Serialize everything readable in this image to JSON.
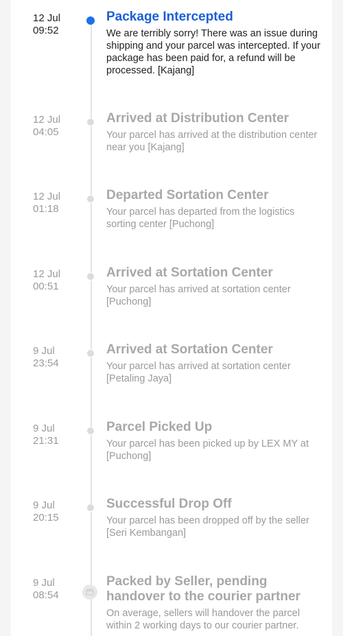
{
  "tracking": {
    "events": [
      {
        "date": "12 Jul",
        "time": "09:52",
        "title": "Package Intercepted",
        "description": "We are terribly sorry! There was an issue during shipping and your parcel was intercepted. If your package has been paid for, a refund will be processed. [Kajang]",
        "status": "current",
        "icon": "active-dot-icon"
      },
      {
        "date": "12 Jul",
        "time": "04:05",
        "title": "Arrived at Distribution Center",
        "description": "Your parcel has arrived at the distribution center near you [Kajang]",
        "status": "past",
        "icon": "dot-icon"
      },
      {
        "date": "12 Jul",
        "time": "01:18",
        "title": "Departed Sortation Center",
        "description": "Your parcel has departed from the logistics sorting center [Puchong]",
        "status": "past",
        "icon": "dot-icon"
      },
      {
        "date": "12 Jul",
        "time": "00:51",
        "title": "Arrived at Sortation Center",
        "description": "Your parcel has arrived at sortation center [Puchong]",
        "status": "past",
        "icon": "dot-icon"
      },
      {
        "date": "9 Jul",
        "time": "23:54",
        "title": "Arrived at Sortation Center",
        "description": "Your parcel has arrived at sortation center [Petaling Jaya]",
        "status": "past",
        "icon": "dot-icon"
      },
      {
        "date": "9 Jul",
        "time": "21:31",
        "title": "Parcel Picked Up",
        "description": "Your parcel has been picked up by LEX MY at [Puchong]",
        "status": "past",
        "icon": "dot-icon"
      },
      {
        "date": "9 Jul",
        "time": "20:15",
        "title": "Successful Drop Off",
        "description": "Your parcel has been dropped off by the seller [Seri Kembangan]",
        "status": "past",
        "icon": "dot-icon"
      },
      {
        "date": "9 Jul",
        "time": "08:54",
        "title": "Packed by Seller, pending handover to the courier partner",
        "description": "On average, sellers will handover the parcel within 2 working days to our courier partner.",
        "status": "past",
        "icon": "package-box-icon"
      }
    ]
  },
  "colors": {
    "active_blue": "#1a5fd6",
    "active_dot": "#1a73e8",
    "muted_text": "#9a9a9a",
    "rail": "#e4e4e4"
  }
}
